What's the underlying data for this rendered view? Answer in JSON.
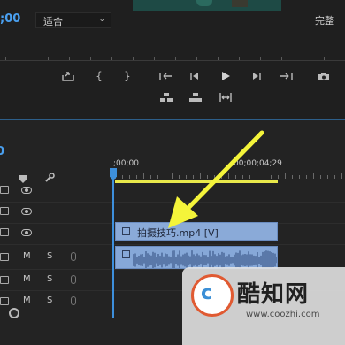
{
  "monitor": {
    "timecode": ";00",
    "fit_label": "适合",
    "quality_label": "完整"
  },
  "timeline": {
    "timecode": "0",
    "ruler_start": ";00;00",
    "ruler_end": "00;00;04;29",
    "track_m": "M",
    "track_s": "S",
    "video_clip_name": "拍摄技巧.mp4 [V]"
  },
  "colors": {
    "accent_blue": "#3d8fdc",
    "clip_blue": "#8aaad8",
    "work_area_yellow": "#e8e84a",
    "arrow_yellow": "#f4f43a"
  },
  "watermark": {
    "logo_text": "c",
    "title": "酷知网",
    "url": "www.coozhi.com"
  }
}
